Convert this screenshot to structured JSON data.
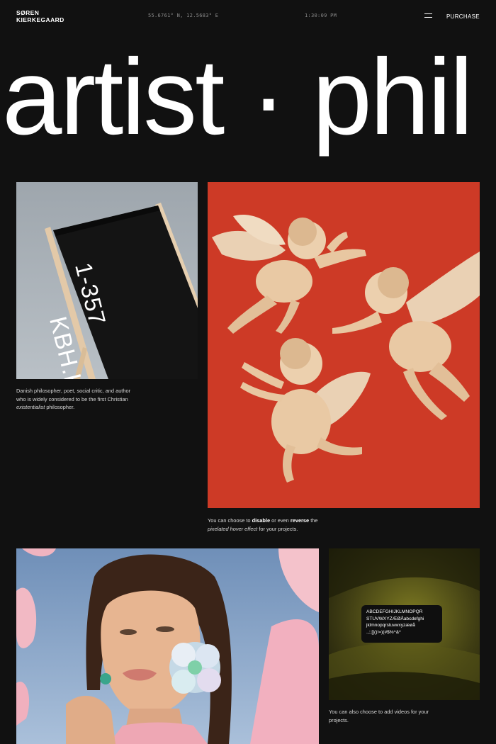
{
  "header": {
    "brand_line1": "SØREN",
    "brand_line2": "KIERKEGAARD",
    "coordinates": "55.6761° N, 12.5683° E",
    "time": "1:30:09 PM",
    "purchase_label": "PURCHASE"
  },
  "hero": {
    "text": "artist · phil"
  },
  "chair_card": {
    "sign_number": "1-357",
    "sign_place": "KBH.K",
    "caption_a": "Danish philosopher, poet, social critic, and author",
    "caption_b": "who is widely considered to be the first Christian",
    "caption_c_em": "existentialist",
    "caption_c_rest": " philosopher."
  },
  "cherubs_card": {
    "caption_1": "You can choose to ",
    "caption_bold1": "disable",
    "caption_2": " or even ",
    "caption_bold2": "reverse",
    "caption_3": " the",
    "caption_em": "pixelated hover effect",
    "caption_4": " for your projects."
  },
  "video_card": {
    "specimen_line1": "ABCDEFGHIJKLMNOPQR",
    "specimen_line2": "STUVWXYZÆØÅabcdefghi",
    "specimen_line3": "jklmnopqrstuvwxyzæøå",
    "specimen_line4": ".,:;[]()!=)(#$%^&*",
    "caption_a": "You can also choose to add videos for your",
    "caption_b": "projects."
  },
  "colors": {
    "background": "#111111",
    "cherub_red": "#cd3a26",
    "sky": "#a9b1b9"
  }
}
